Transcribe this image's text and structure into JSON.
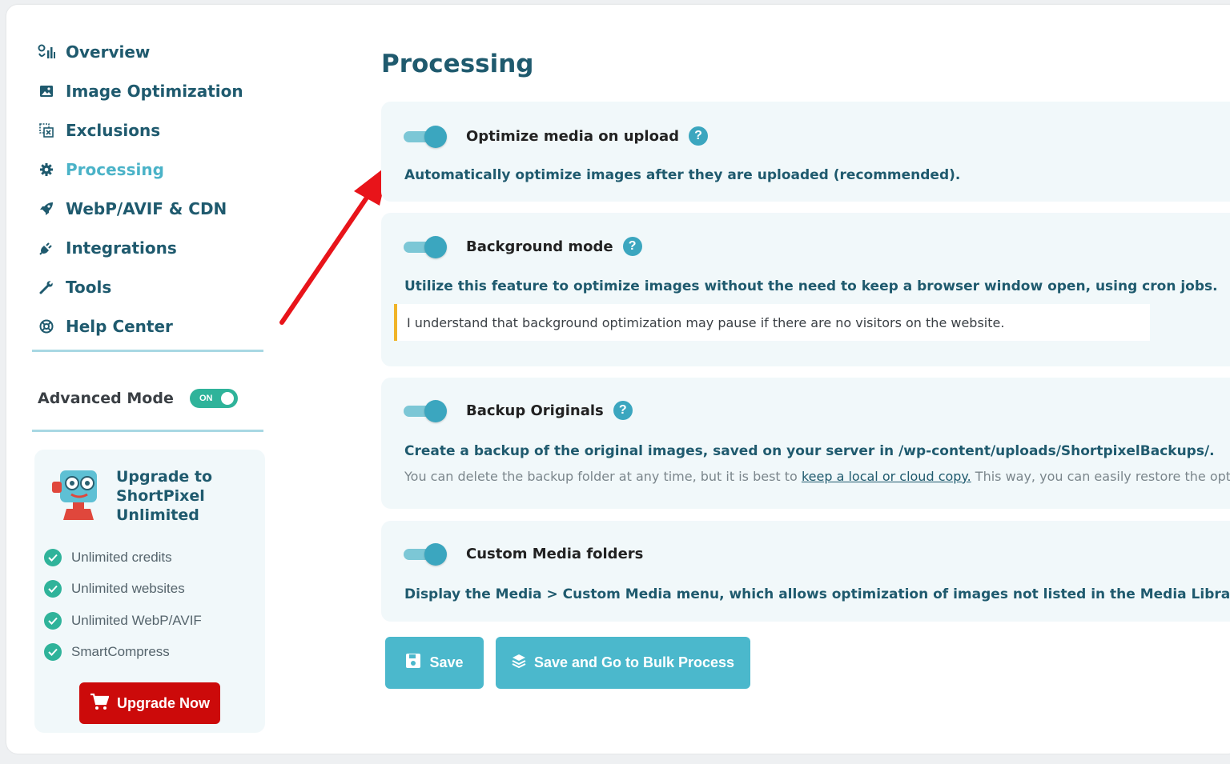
{
  "sidebar": {
    "items": [
      {
        "label": "Overview",
        "icon": "chart-icon"
      },
      {
        "label": "Image Optimization",
        "icon": "image-icon"
      },
      {
        "label": "Exclusions",
        "icon": "exclusions-icon"
      },
      {
        "label": "Processing",
        "icon": "gear-icon",
        "active": true
      },
      {
        "label": "WebP/AVIF & CDN",
        "icon": "rocket-icon"
      },
      {
        "label": "Integrations",
        "icon": "plug-icon"
      },
      {
        "label": "Tools",
        "icon": "wrench-icon"
      },
      {
        "label": "Help Center",
        "icon": "lifebuoy-icon"
      }
    ],
    "advanced_mode": {
      "label": "Advanced Mode",
      "toggle_text": "ON",
      "state": "on"
    }
  },
  "upgrade": {
    "title": "Upgrade to ShortPixel Unlimited",
    "features": [
      "Unlimited credits",
      "Unlimited websites",
      "Unlimited WebP/AVIF",
      "SmartCompress"
    ],
    "button": "Upgrade Now"
  },
  "main": {
    "title": "Processing",
    "options": [
      {
        "label": "Optimize media on upload",
        "help": true,
        "enabled": true,
        "description": "Automatically optimize images after they are uploaded (recommended)."
      },
      {
        "label": "Background mode",
        "help": true,
        "enabled": true,
        "description": "Utilize this feature to optimize images without the need to keep a browser window open, using cron jobs.",
        "note": "I understand that background optimization may pause if there are no visitors on the website."
      },
      {
        "label": "Backup Originals",
        "help": true,
        "enabled": true,
        "description": "Create a backup of the original images, saved on your server in /wp-content/uploads/ShortpixelBackups/.",
        "sub_before": "You can delete the backup folder at any time, but it is best to ",
        "sub_link": "keep a local or cloud copy.",
        "sub_after": " This way, you can easily restore the optimized fil"
      },
      {
        "label": "Custom Media folders",
        "help": false,
        "enabled": true,
        "description": "Display the Media > Custom Media menu, which allows optimization of images not listed in the Media Library."
      }
    ],
    "buttons": {
      "save": "Save",
      "save_bulk": "Save and Go to Bulk Process"
    }
  },
  "colors": {
    "accent": "#4bb3c8",
    "primary_text": "#1f5a6e",
    "upgrade_red": "#cc0a0a",
    "toggle_on": "#2fb39a",
    "arrow": "#e8141a"
  }
}
